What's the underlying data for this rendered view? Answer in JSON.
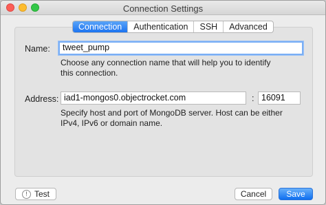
{
  "window": {
    "title": "Connection Settings"
  },
  "tabs": [
    {
      "label": "Connection",
      "active": true
    },
    {
      "label": "Authentication",
      "active": false
    },
    {
      "label": "SSH",
      "active": false
    },
    {
      "label": "Advanced",
      "active": false
    }
  ],
  "name": {
    "label": "Name:",
    "value": "tweet_pump",
    "help": "Choose any connection name that will help you to identify this connection."
  },
  "address": {
    "label": "Address:",
    "host_value": "iad1-mongos0.objectrocket.com",
    "separator": ":",
    "port_value": "16091",
    "help": "Specify host and port of MongoDB server. Host can be either IPv4, IPv6 or domain name."
  },
  "buttons": {
    "test_label": "Test",
    "test_icon": "!",
    "cancel_label": "Cancel",
    "save_label": "Save"
  },
  "colors": {
    "accent": "#1c73f0",
    "window_bg": "#ececec",
    "close": "#fc5e56",
    "minimize": "#fdbc2e",
    "maximize": "#33c748"
  }
}
